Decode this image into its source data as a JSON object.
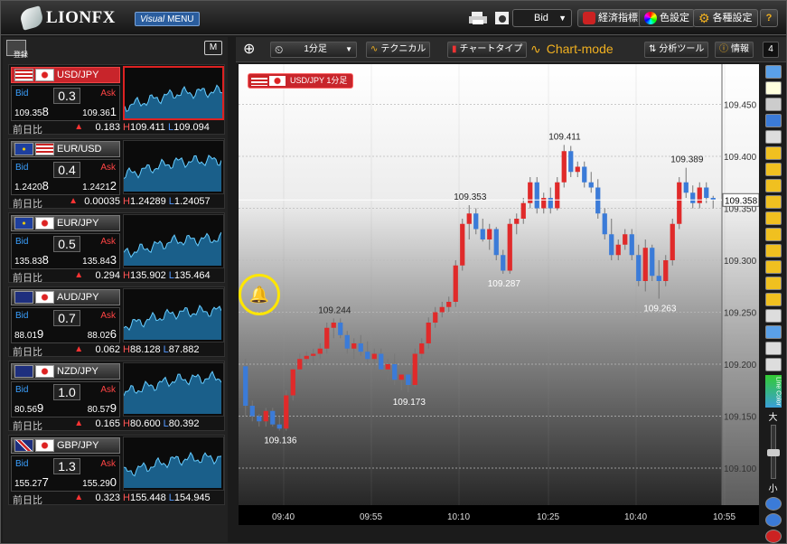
{
  "app": {
    "logo_text": "LIONFX",
    "visual_menu": "Visual MENU",
    "visual_menu_italic": "Visual",
    "visual_menu_rest": "MENU"
  },
  "topbar": {
    "bid_select": "Bid",
    "econ": "経済指標",
    "color": "色設定",
    "settings": "各種設定",
    "help": "?"
  },
  "sidebar": {
    "register": "登録",
    "menu_icon": "M"
  },
  "cards": [
    {
      "pair": "USD/JPY",
      "flag1": "us",
      "flag2": "jp",
      "spread": "0.3",
      "bid": "109.35",
      "bid_big": "8",
      "ask": "109.36",
      "ask_big": "1",
      "chg_label": "前日比",
      "chg": "0.183",
      "high": "109.411",
      "low": "109.094",
      "active": true
    },
    {
      "pair": "EUR/USD",
      "flag1": "eu",
      "flag2": "us",
      "spread": "0.4",
      "bid": "1.2420",
      "bid_big": "8",
      "ask": "1.2421",
      "ask_big": "2",
      "chg_label": "前日比",
      "chg": "0.00035",
      "high": "1.24289",
      "low": "1.24057"
    },
    {
      "pair": "EUR/JPY",
      "flag1": "eu",
      "flag2": "jp",
      "spread": "0.5",
      "bid": "135.83",
      "bid_big": "8",
      "ask": "135.84",
      "ask_big": "3",
      "chg_label": "前日比",
      "chg": "0.294",
      "high": "135.902",
      "low": "135.464"
    },
    {
      "pair": "AUD/JPY",
      "flag1": "au",
      "flag2": "jp",
      "spread": "0.7",
      "bid": "88.01",
      "bid_big": "9",
      "ask": "88.02",
      "ask_big": "6",
      "chg_label": "前日比",
      "chg": "0.062",
      "high": "88.128",
      "low": "87.882"
    },
    {
      "pair": "NZD/JPY",
      "flag1": "nz",
      "flag2": "jp",
      "spread": "1.0",
      "bid": "80.56",
      "bid_big": "9",
      "ask": "80.57",
      "ask_big": "9",
      "chg_label": "前日比",
      "chg": "0.165",
      "high": "80.600",
      "low": "80.392"
    },
    {
      "pair": "GBP/JPY",
      "flag1": "gb",
      "flag2": "jp",
      "spread": "1.3",
      "bid": "155.27",
      "bid_big": "7",
      "ask": "155.29",
      "ask_big": "0",
      "chg_label": "前日比",
      "chg": "0.323",
      "high": "155.448",
      "low": "154.945"
    }
  ],
  "labels": {
    "bid": "Bid",
    "ask": "Ask",
    "h": "H",
    "l": "L"
  },
  "charthead": {
    "period": "1分足",
    "technical": "テクニカル",
    "charttype": "チャートタイプ",
    "mode": "Chart-mode",
    "analysis": "分析ツール",
    "info": "情報",
    "count": "4"
  },
  "chart": {
    "symbol_tag": "USD/JPY 1分足",
    "current_price": "109.358",
    "y_ticks": [
      "109.450",
      "109.400",
      "109.350",
      "109.300",
      "109.250",
      "109.200",
      "109.150",
      "109.100"
    ],
    "x_ticks": [
      "09:40",
      "09:55",
      "10:10",
      "10:25",
      "10:40",
      "10:55"
    ],
    "annotations": [
      "109.411",
      "109.389",
      "109.353",
      "109.287",
      "109.263",
      "109.244",
      "109.173",
      "109.136"
    ],
    "zoom_big": "大",
    "zoom_small": "小",
    "line_color": "Line Color"
  },
  "colors": {
    "up": "#e02a2a",
    "down": "#3b7bd8",
    "active_red": "#c8252b"
  },
  "chart_data": {
    "type": "candlestick",
    "title": "USD/JPY 1分足",
    "ylim": [
      109.08,
      109.48
    ],
    "x": [
      "09:40",
      "09:55",
      "10:10",
      "10:25",
      "10:40",
      "10:55"
    ],
    "candles": [
      [
        109.198,
        109.205,
        109.15,
        109.16
      ],
      [
        109.16,
        109.165,
        109.145,
        109.15
      ],
      [
        109.15,
        109.152,
        109.14,
        109.145
      ],
      [
        109.145,
        109.158,
        109.14,
        109.155
      ],
      [
        109.155,
        109.158,
        109.14,
        109.142
      ],
      [
        109.142,
        109.15,
        109.136,
        109.138
      ],
      [
        109.138,
        109.175,
        109.136,
        109.17
      ],
      [
        109.17,
        109.2,
        109.165,
        109.195
      ],
      [
        109.195,
        109.21,
        109.19,
        109.205
      ],
      [
        109.205,
        109.212,
        109.198,
        109.208
      ],
      [
        109.208,
        109.215,
        109.2,
        109.21
      ],
      [
        109.21,
        109.22,
        109.205,
        109.215
      ],
      [
        109.215,
        109.24,
        109.21,
        109.235
      ],
      [
        109.235,
        109.244,
        109.225,
        109.24
      ],
      [
        109.24,
        109.244,
        109.225,
        109.228
      ],
      [
        109.228,
        109.232,
        109.21,
        109.215
      ],
      [
        109.215,
        109.225,
        109.205,
        109.22
      ],
      [
        109.22,
        109.228,
        109.208,
        109.212
      ],
      [
        109.212,
        109.222,
        109.2,
        109.205
      ],
      [
        109.205,
        109.215,
        109.195,
        109.21
      ],
      [
        109.21,
        109.215,
        109.19,
        109.195
      ],
      [
        109.195,
        109.205,
        109.185,
        109.2
      ],
      [
        109.2,
        109.21,
        109.18,
        109.185
      ],
      [
        109.185,
        109.195,
        109.175,
        109.19
      ],
      [
        109.19,
        109.195,
        109.173,
        109.18
      ],
      [
        109.18,
        109.215,
        109.178,
        109.21
      ],
      [
        109.21,
        109.225,
        109.205,
        109.22
      ],
      [
        109.22,
        109.245,
        109.215,
        109.24
      ],
      [
        109.24,
        109.255,
        109.235,
        109.25
      ],
      [
        109.25,
        109.26,
        109.245,
        109.255
      ],
      [
        109.255,
        109.265,
        109.25,
        109.26
      ],
      [
        109.26,
        109.3,
        109.255,
        109.295
      ],
      [
        109.295,
        109.34,
        109.29,
        109.335
      ],
      [
        109.335,
        109.353,
        109.32,
        109.345
      ],
      [
        109.345,
        109.35,
        109.325,
        109.33
      ],
      [
        109.33,
        109.34,
        109.318,
        109.32
      ],
      [
        109.32,
        109.335,
        109.31,
        109.33
      ],
      [
        109.33,
        109.332,
        109.3,
        109.305
      ],
      [
        109.305,
        109.31,
        109.287,
        109.29
      ],
      [
        109.29,
        109.34,
        109.287,
        109.335
      ],
      [
        109.335,
        109.345,
        109.325,
        109.34
      ],
      [
        109.34,
        109.36,
        109.335,
        109.355
      ],
      [
        109.355,
        109.38,
        109.35,
        109.375
      ],
      [
        109.375,
        109.38,
        109.345,
        109.35
      ],
      [
        109.35,
        109.365,
        109.345,
        109.36
      ],
      [
        109.36,
        109.37,
        109.345,
        109.35
      ],
      [
        109.35,
        109.38,
        109.348,
        109.375
      ],
      [
        109.375,
        109.411,
        109.37,
        109.405
      ],
      [
        109.405,
        109.41,
        109.38,
        109.385
      ],
      [
        109.385,
        109.395,
        109.38,
        109.39
      ],
      [
        109.39,
        109.395,
        109.37,
        109.375
      ],
      [
        109.375,
        109.385,
        109.365,
        109.37
      ],
      [
        109.37,
        109.378,
        109.34,
        109.345
      ],
      [
        109.345,
        109.35,
        109.32,
        109.325
      ],
      [
        109.325,
        109.34,
        109.3,
        109.305
      ],
      [
        109.305,
        109.32,
        109.3,
        109.315
      ],
      [
        109.315,
        109.33,
        109.31,
        109.325
      ],
      [
        109.325,
        109.33,
        109.3,
        109.305
      ],
      [
        109.305,
        109.315,
        109.275,
        109.28
      ],
      [
        109.28,
        109.32,
        109.27,
        109.312
      ],
      [
        109.312,
        109.315,
        109.28,
        109.285
      ],
      [
        109.285,
        109.3,
        109.263,
        109.28
      ],
      [
        109.28,
        109.305,
        109.275,
        109.3
      ],
      [
        109.3,
        109.34,
        109.295,
        109.335
      ],
      [
        109.335,
        109.38,
        109.33,
        109.375
      ],
      [
        109.375,
        109.389,
        109.36,
        109.365
      ],
      [
        109.365,
        109.372,
        109.35,
        109.355
      ],
      [
        109.355,
        109.375,
        109.35,
        109.37
      ],
      [
        109.37,
        109.375,
        109.355,
        109.36
      ],
      [
        109.36,
        109.362,
        109.35,
        109.358
      ]
    ]
  }
}
